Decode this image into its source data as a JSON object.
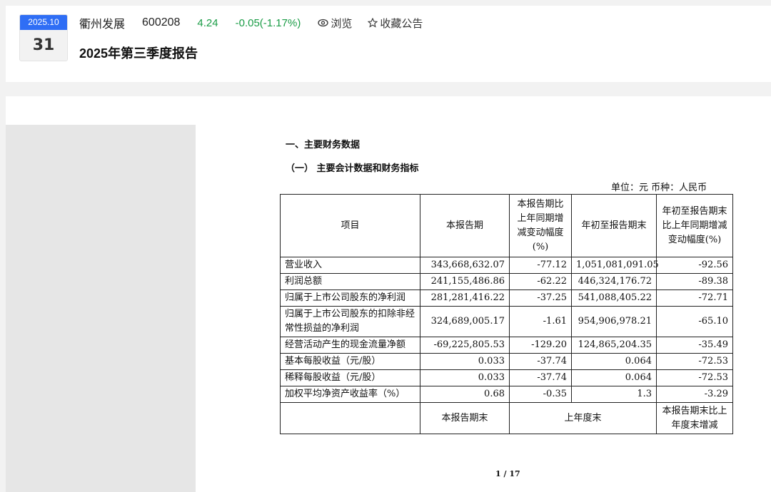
{
  "header": {
    "date_month": "2025.10",
    "date_day": "31",
    "stock_name": "衢州发展",
    "stock_code": "600208",
    "price": "4.24",
    "change": "-0.05(-1.17%)",
    "browse_label": "浏览",
    "favorite_label": "收藏公告",
    "report_title": "2025年第三季度报告",
    "colors": {
      "accent": "#2f6ef5",
      "down": "#1a9c46"
    }
  },
  "document": {
    "section1": "一、主要财务数据",
    "section2": "（一）  主要会计数据和财务指标",
    "unit": "单位：元    币种：人民币",
    "table": {
      "headers": [
        "项目",
        "本报告期",
        "本报告期比上年同期增减变动幅度(%)",
        "年初至报告期末",
        "年初至报告期末比上年同期增减变动幅度(%)"
      ],
      "rows": [
        [
          "营业收入",
          "343,668,632.07",
          "-77.12",
          "1,051,081,091.05",
          "-92.56"
        ],
        [
          "利润总额",
          "241,155,486.86",
          "-62.22",
          "446,324,176.72",
          "-89.38"
        ],
        [
          "归属于上市公司股东的净利润",
          "281,281,416.22",
          "-37.25",
          "541,088,405.22",
          "-72.71"
        ],
        [
          "归属于上市公司股东的扣除非经常性损益的净利润",
          "324,689,005.17",
          "-1.61",
          "954,906,978.21",
          "-65.10"
        ],
        [
          "经营活动产生的现金流量净额",
          "-69,225,805.53",
          "-129.20",
          "124,865,204.35",
          "-35.49"
        ],
        [
          "基本每股收益（元/股）",
          "0.033",
          "-37.74",
          "0.064",
          "-72.53"
        ],
        [
          "稀释每股收益（元/股）",
          "0.033",
          "-37.74",
          "0.064",
          "-72.53"
        ],
        [
          "加权平均净资产收益率（%）",
          "0.68",
          "-0.35",
          "1.3",
          "-3.29"
        ]
      ],
      "footer": [
        "",
        "本报告期末",
        "上年度末",
        "本报告期末比上年度末增减"
      ]
    },
    "page_number": "1 / 17"
  }
}
